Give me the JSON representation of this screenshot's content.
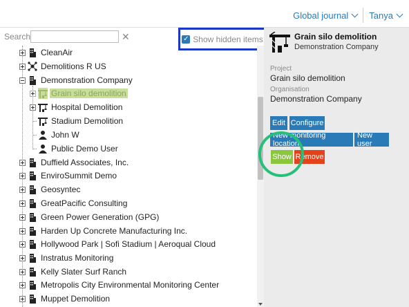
{
  "topnav": {
    "journal": "Global journal",
    "user": "Tanya"
  },
  "search": {
    "label": "Search",
    "value": "",
    "placeholder": "",
    "clear": "✕"
  },
  "hidden_toggle": {
    "label": "Show hidden items",
    "checked": true,
    "check": "✓"
  },
  "tree": {
    "items": [
      "CleanAir",
      "Demolitions R US",
      "Demonstration Company",
      "Grain silo demolition",
      "Hospital Demolition",
      "Stadium Demolition",
      "John W",
      "Public Demo User",
      "Duffield Associates, Inc.",
      "EnviroSummit Demo",
      "Geosyntec",
      "GreatPacific Consulting",
      "Green Power Generation (GPG)",
      "Harden Up Concrete Manufacturing Inc.",
      "Hollywood Park | Sofi Stadium | Aeroqual Cloud",
      "Instratus Monitoring",
      "Kelly Slater Surf Ranch",
      "Metropolis City Environmental Monitoring Center",
      "Muppet Demolition"
    ]
  },
  "detail": {
    "title": "Grain silo demolition",
    "subtitle": "Demonstration Company",
    "project_label": "Project",
    "project_value": "Grain silo demolition",
    "org_label": "Organisation",
    "org_value": "Demonstration Company",
    "buttons": {
      "edit": "Edit",
      "configure": "Configure",
      "new_location": "New monitoring location",
      "new_user": "New user",
      "show": "Show",
      "remove": "Remove"
    }
  },
  "colors": {
    "accent": "#2a7ab8",
    "show": "#8cc63f",
    "remove": "#e4421a",
    "highlight_box": "#1b37c5",
    "highlight_circle": "#26c07a",
    "selected_bg": "#c8dd9a"
  }
}
